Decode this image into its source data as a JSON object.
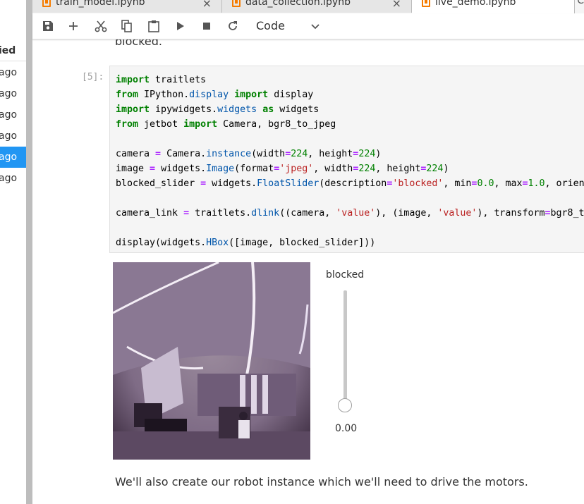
{
  "file_browser": {
    "column_header": "ied",
    "rows": [
      "ago",
      "ago",
      "ago",
      "ago",
      "ago",
      "ago"
    ],
    "selected_index": 4
  },
  "tabs": [
    {
      "label": "train_model.ipynb",
      "close": "×"
    },
    {
      "label": "data_collection.ipynb",
      "close": "×"
    },
    {
      "label": "live_demo.ipynb",
      "close": ""
    }
  ],
  "tab_more": "C",
  "toolbar": {
    "cell_type": "Code"
  },
  "notebook": {
    "prev_text": "blocked.",
    "cell_prompt": "[5]:",
    "slider": {
      "label": "blocked",
      "value_text": "0.00",
      "value": 0.0
    },
    "next_text": "We'll also create our robot instance which we'll need to drive the motors."
  },
  "colors": {
    "accent": "#2196f3",
    "tab_icon": "#f57c00",
    "keyword": "#008000",
    "string": "#ba2121"
  }
}
